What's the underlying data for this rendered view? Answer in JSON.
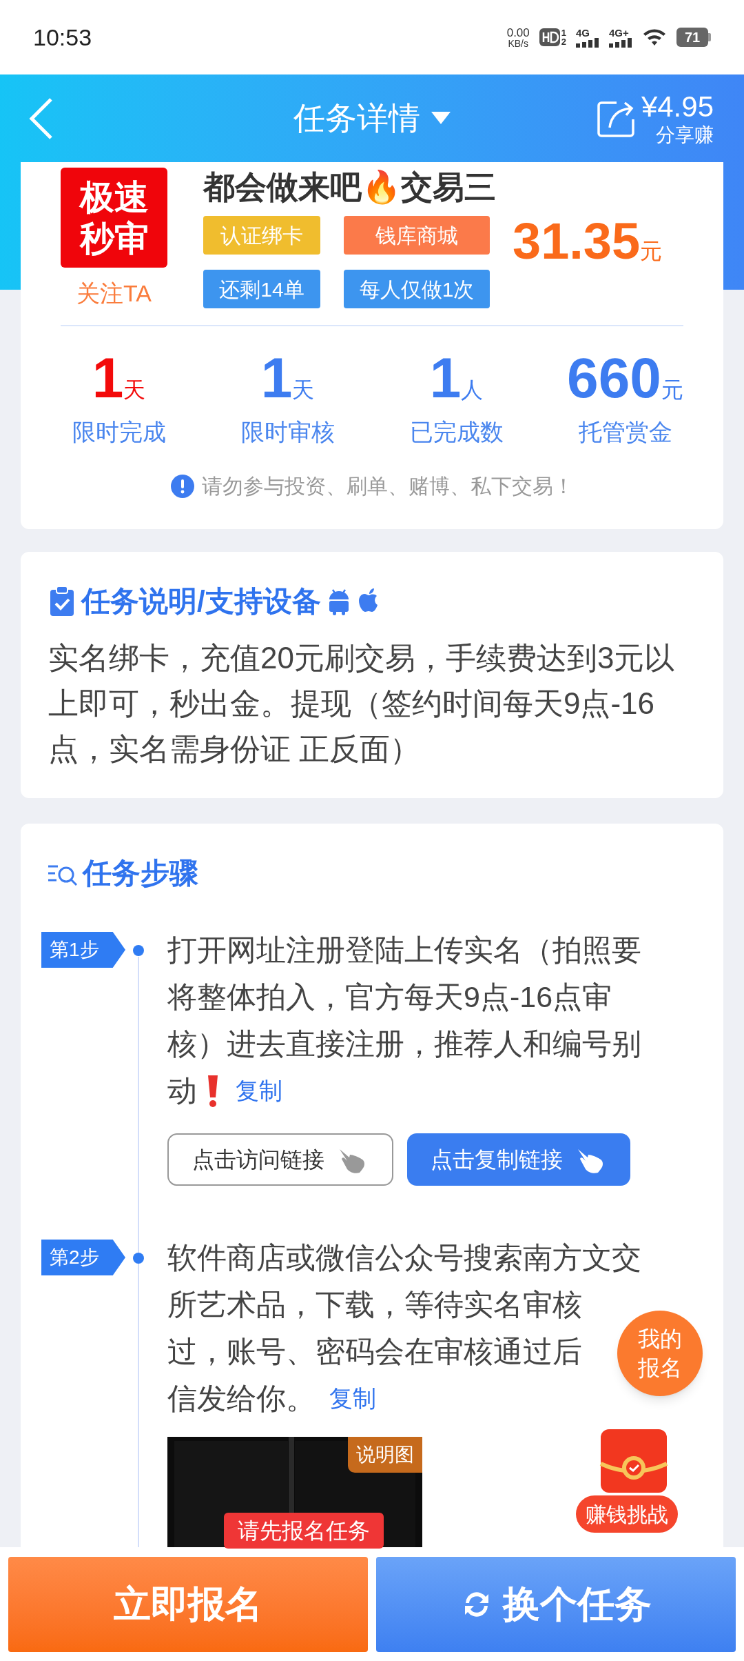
{
  "status_bar": {
    "time": "10:53",
    "net_speed": "0.00",
    "net_unit": "KB/s",
    "sim_marks": [
      "1",
      "2"
    ],
    "networks": [
      "4G",
      "4G+"
    ],
    "battery": "71"
  },
  "header": {
    "title": "任务详情",
    "share_amount": "¥4.95",
    "share_label": "分享赚"
  },
  "task": {
    "badge_lines": [
      "极速",
      "秒审"
    ],
    "follow": "关注TA",
    "title": "都会做来吧🔥交易三",
    "price": "31.35",
    "price_unit": "元",
    "tags": [
      {
        "text": "认证绑卡",
        "color": "#f0bd2e"
      },
      {
        "text": "钱库商城",
        "color": "#fb7a4a"
      },
      {
        "text": "还剩14单",
        "color": "#3d95ef"
      },
      {
        "text": "每人仅做1次",
        "color": "#3d95ef"
      }
    ]
  },
  "stats": [
    {
      "value": "1",
      "unit": "天",
      "label": "限时完成",
      "highlight": true
    },
    {
      "value": "1",
      "unit": "天",
      "label": "限时审核",
      "highlight": false
    },
    {
      "value": "1",
      "unit": "人",
      "label": "已完成数",
      "highlight": false
    },
    {
      "value": "660",
      "unit": "元",
      "label": "托管赏金",
      "highlight": false
    }
  ],
  "warning": "请勿参与投资、刷单、赌博、私下交易！",
  "description": {
    "title": "任务说明/支持设备",
    "text": "实名绑卡，充值20元刷交易，手续费达到3元以上即可，秒出金。提现（签约时间每天9点-16点，实名需身份证 正反面）"
  },
  "steps": {
    "title": "任务步骤",
    "items": [
      {
        "badge": "第1步",
        "lines": [
          "打开网址注册登陆上传实名（拍照要",
          "将整体拍入，官方每天9点-16点审",
          "核）进去直接注册，推荐人和编号别",
          "动"
        ],
        "alert": true,
        "copy": "复制",
        "buttons": [
          {
            "text": "点击访问链接",
            "primary": false
          },
          {
            "text": "点击复制链接",
            "primary": true
          }
        ]
      },
      {
        "badge": "第2步",
        "lines": [
          "软件商店或微信公众号搜索南方文交",
          "所艺术品，下载，等待实名审核",
          "过，账号、密码会在审核通过后",
          "信发给你。"
        ],
        "copy": "复制",
        "image": {
          "kind": "picture",
          "tag": "说明图"
        }
      }
    ]
  },
  "tooltip": "请先报名任务",
  "floating": {
    "my_signup": [
      "我的",
      "报名"
    ],
    "challenge": "赚钱挑战"
  },
  "bottom_bar": {
    "signup": "立即报名",
    "switch": "换个任务"
  }
}
